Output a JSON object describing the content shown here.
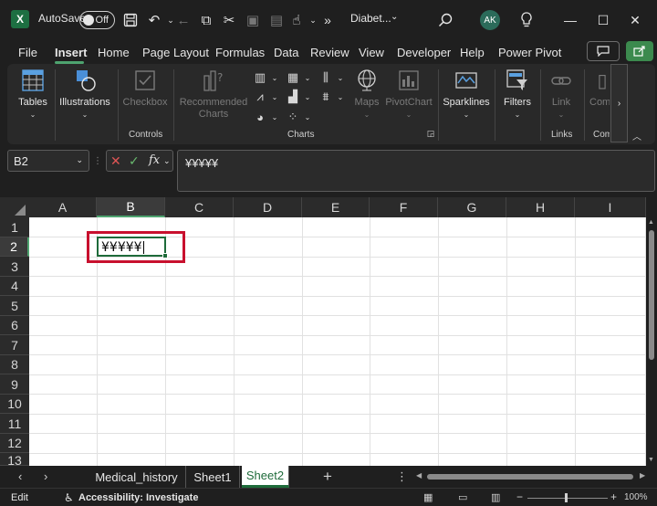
{
  "title_bar": {
    "app_icon": "excel-icon",
    "app_letter": "X",
    "autosave_label": "AutoSave",
    "autosave_state": "Off",
    "save_icon": "save-icon",
    "undo_icon": "undo-icon",
    "more_commands": "»",
    "file_name": "Diabet...",
    "search_icon": "search-icon",
    "avatar_initials": "AK",
    "lightbulb_icon": "lightbulb-icon"
  },
  "menu": {
    "items": [
      "File",
      "Insert",
      "Home",
      "Page Layout",
      "Formulas",
      "Data",
      "Review",
      "View",
      "Developer",
      "Help",
      "Power Pivot"
    ],
    "active": "Insert"
  },
  "ribbon": {
    "tables": "Tables",
    "illustrations": "Illustrations",
    "checkbox": "Checkbox",
    "recommended_charts_1": "Recommended",
    "recommended_charts_2": "Charts",
    "maps": "Maps",
    "pivotchart": "PivotChart",
    "sparklines": "Sparklines",
    "filters": "Filters",
    "link": "Link",
    "comments_partial": "Com",
    "groups": {
      "controls": "Controls",
      "charts": "Charts",
      "links": "Links",
      "comments_partial": "Com"
    }
  },
  "formula_bar": {
    "name_box": "B2",
    "fx_label": "fx",
    "content": "¥¥¥¥¥"
  },
  "grid": {
    "columns": [
      "A",
      "B",
      "C",
      "D",
      "E",
      "F",
      "G",
      "H",
      "I"
    ],
    "rows": [
      "1",
      "2",
      "3",
      "4",
      "5",
      "6",
      "7",
      "8",
      "9",
      "10",
      "11",
      "12",
      "13"
    ],
    "selected_column": "B",
    "selected_row": "2",
    "active_cell": "B2",
    "active_cell_value": "¥¥¥¥¥"
  },
  "sheet_tabs": {
    "tabs": [
      "Medical_history",
      "Sheet1",
      "Sheet2"
    ],
    "active": "Sheet2"
  },
  "status_bar": {
    "mode": "Edit",
    "accessibility": "Accessibility: Investigate",
    "zoom": "100%"
  },
  "colors": {
    "accent_green": "#1e6b3a",
    "highlight_red": "#c8102e",
    "background": "#1f1f1f",
    "ribbon": "#292929"
  }
}
